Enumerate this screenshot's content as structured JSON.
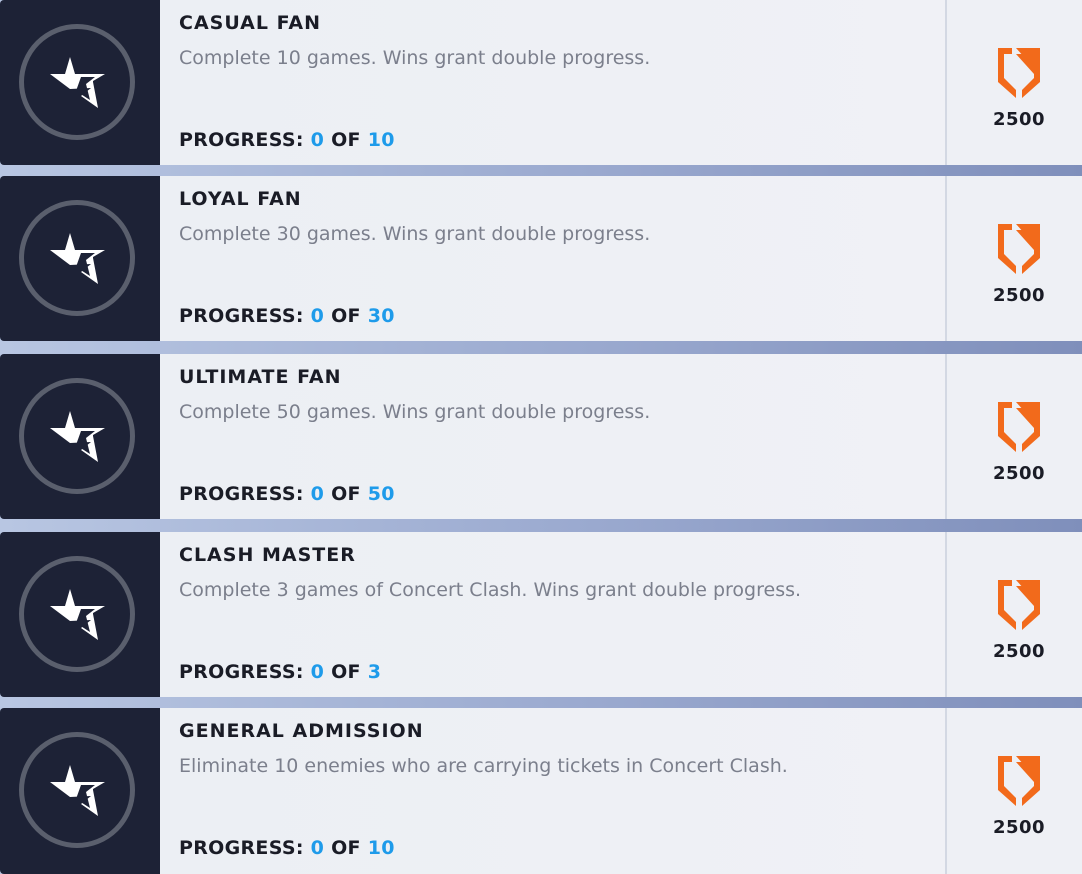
{
  "challenges": [
    {
      "title": "CASUAL FAN",
      "description": "Complete 10 games. Wins grant double progress.",
      "progress_label": "PROGRESS:",
      "current": "0",
      "of_label": "OF",
      "total": "10",
      "reward": "2500"
    },
    {
      "title": "LOYAL FAN",
      "description": "Complete 30 games. Wins grant double progress.",
      "progress_label": "PROGRESS:",
      "current": "0",
      "of_label": "OF",
      "total": "30",
      "reward": "2500"
    },
    {
      "title": "ULTIMATE FAN",
      "description": "Complete 50 games. Wins grant double progress.",
      "progress_label": "PROGRESS:",
      "current": "0",
      "of_label": "OF",
      "total": "50",
      "reward": "2500"
    },
    {
      "title": "CLASH MASTER",
      "description": "Complete 3 games of Concert Clash. Wins grant double progress.",
      "progress_label": "PROGRESS:",
      "current": "0",
      "of_label": "OF",
      "total": "3",
      "reward": "2500"
    },
    {
      "title": "GENERAL ADMISSION",
      "description": "Eliminate 10 enemies who are carrying tickets in Concert Clash.",
      "progress_label": "PROGRESS:",
      "current": "0",
      "of_label": "OF",
      "total": "10",
      "reward": "2500"
    }
  ],
  "icons": {
    "challenge": "star-icon",
    "reward": "battle-pass-xp-shield-icon"
  },
  "colors": {
    "accent": "#1e9bea",
    "reward": "#f26a1b",
    "icon_bg": "#1d2236"
  }
}
